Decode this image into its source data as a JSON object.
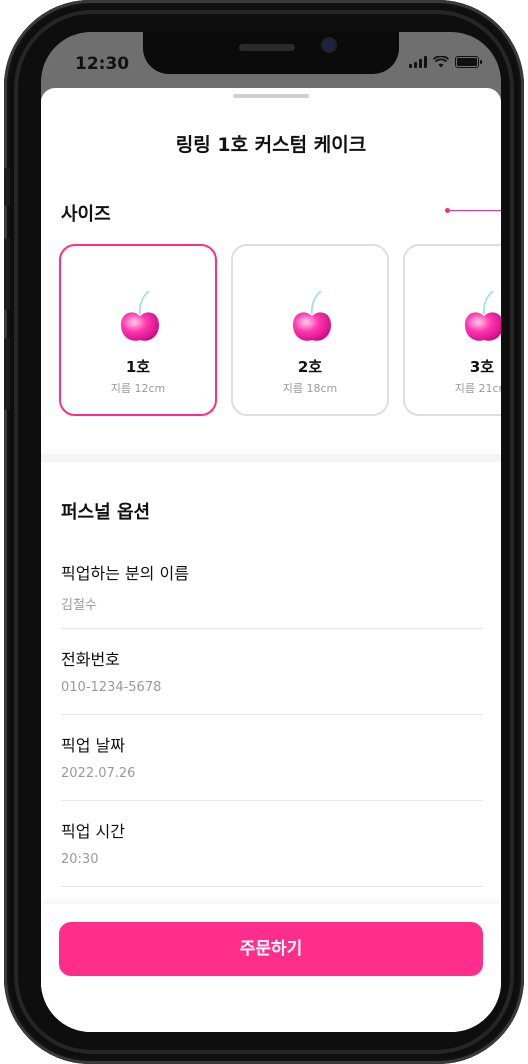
{
  "status_bar": {
    "time": "12:30"
  },
  "sheet": {
    "title": "링링 1호 커스텀 케이크"
  },
  "size_section": {
    "title": "사이즈",
    "options": [
      {
        "name": "1호",
        "diameter": "지름 12cm",
        "selected": true
      },
      {
        "name": "2호",
        "diameter": "지름 18cm",
        "selected": false
      },
      {
        "name": "3호",
        "diameter": "지름 21cm",
        "selected": false
      }
    ]
  },
  "personal_options": {
    "title": "퍼스널 옵션",
    "fields": [
      {
        "label": "픽업하는 분의 이름",
        "value": "김철수"
      },
      {
        "label": "전화번호",
        "value": "010-1234-5678"
      },
      {
        "label": "픽업 날짜",
        "value": "2022.07.26"
      },
      {
        "label": "픽업 시간",
        "value": "20:30"
      }
    ]
  },
  "order_button": {
    "label": "주문하기"
  },
  "colors": {
    "accent": "#ff2d8c",
    "annotation": "#e8338a"
  }
}
